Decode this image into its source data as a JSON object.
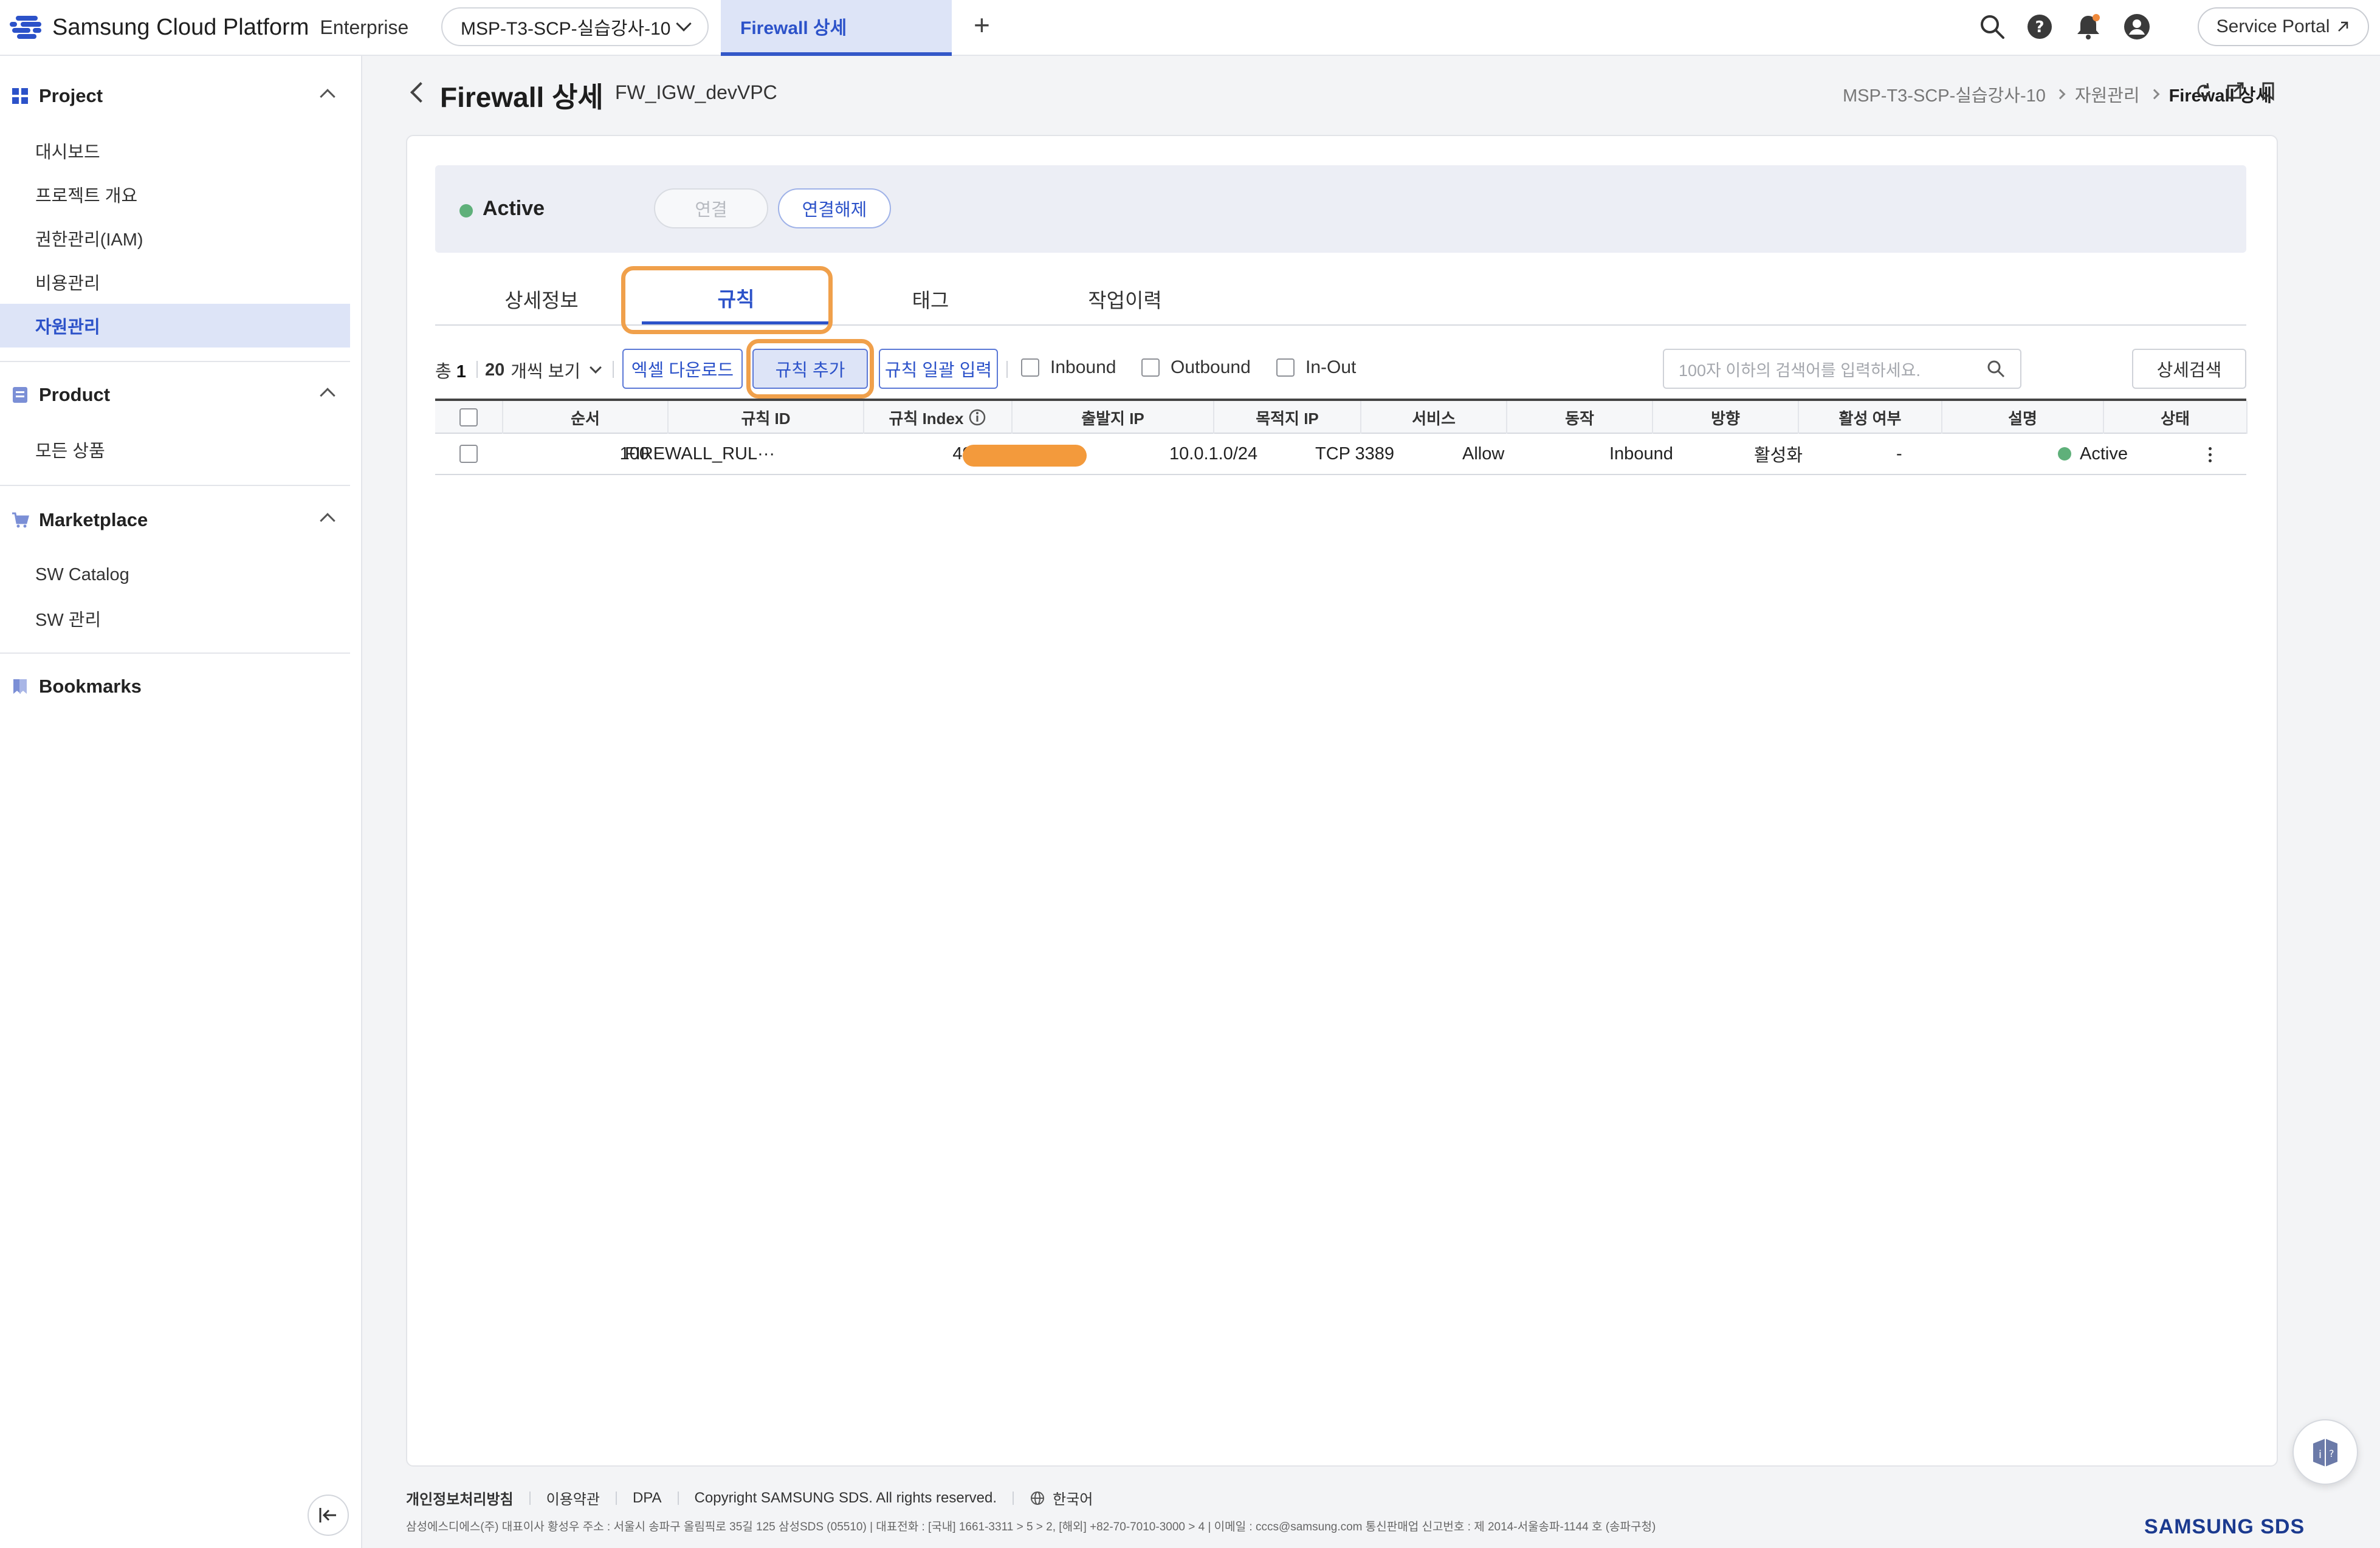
{
  "topbar": {
    "brand": "Samsung Cloud Platform",
    "brand_sub": "Enterprise",
    "project_select": "MSP-T3-SCP-실습강사-10",
    "active_tab": "Firewall 상세",
    "add_tab": "+",
    "service_portal": "Service Portal",
    "icons": [
      "search-icon",
      "help-icon",
      "bell-icon",
      "user-icon"
    ],
    "accent_color": "#2c52c9"
  },
  "sidebar": {
    "sections": [
      {
        "title": "Project",
        "items": [
          "대시보드",
          "프로젝트 개요",
          "권한관리(IAM)",
          "비용관리",
          "자원관리"
        ],
        "active": "자원관리"
      },
      {
        "title": "Product",
        "items": [
          "모든 상품"
        ]
      },
      {
        "title": "Marketplace",
        "items": [
          "SW Catalog",
          "SW 관리"
        ]
      },
      {
        "title": "Bookmarks",
        "items": []
      }
    ]
  },
  "header": {
    "title": "Firewall 상세",
    "subtitle": "FW_IGW_devVPC",
    "breadcrumb": [
      "MSP-T3-SCP-실습강사-10",
      "자원관리",
      "Firewall 상세"
    ]
  },
  "status": {
    "state": "Active",
    "state_color": "#5fb07a",
    "connect": "연결",
    "disconnect": "연결해제"
  },
  "tabs": [
    "상세정보",
    "규칙",
    "태그",
    "작업이력"
  ],
  "active_tab": "규칙",
  "toolbar": {
    "total_label": "총",
    "total_count": "1",
    "per_page_count": "20",
    "per_page_label": "개씩 보기",
    "excel_download": "엑셀 다운로드",
    "add_rule": "규칙 추가",
    "bulk_input": "규칙 일괄 입력",
    "filters": [
      "Inbound",
      "Outbound",
      "In-Out"
    ],
    "search_placeholder": "100자 이하의 검색어를 입력하세요.",
    "advanced_search": "상세검색"
  },
  "table": {
    "columns": [
      "순서",
      "규칙 ID",
      "규칙 Index",
      "출발지 IP",
      "목적지 IP",
      "서비스",
      "동작",
      "방향",
      "활성 여부",
      "설명",
      "상태"
    ],
    "rows": [
      {
        "order": "100",
        "rule_id": "FIREWALL_RUL···",
        "rule_index": "49330",
        "source_ip": "",
        "dest_ip": "10.0.1.0/24",
        "service": "TCP 3389",
        "action": "Allow",
        "direction": "Inbound",
        "enabled": "활성화",
        "description": "-",
        "status": "Active"
      }
    ]
  },
  "footer": {
    "links": [
      "개인정보처리방침",
      "이용약관",
      "DPA",
      "Copyright SAMSUNG SDS. All rights reserved.",
      "한국어"
    ],
    "address": "삼성에스디에스(주) 대표이사 황성우 주소 : 서울시 송파구 올림픽로 35길 125 삼성SDS (05510) | 대표전화 : [국내] 1661-3311 > 5 > 2, [해외] +82-70-7010-3000 > 4 | 이메일 : cccs@samsung.com 통신판매업 신고번호 : 제 2014-서울송파-1144 호 (송파구청)",
    "brand": "SAMSUNG SDS"
  },
  "annotation_color": "#f0a04b"
}
